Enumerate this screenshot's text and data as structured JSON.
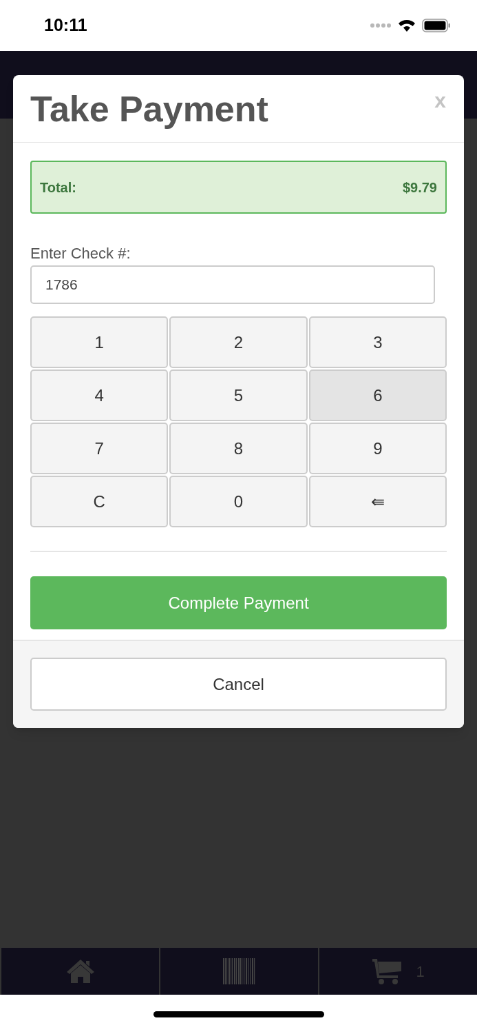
{
  "status_bar": {
    "time": "10:11"
  },
  "modal": {
    "title": "Take Payment",
    "close": "x",
    "total": {
      "label": "Total:",
      "amount": "$9.79"
    },
    "check_field": {
      "label": "Enter Check #:",
      "value": "1786"
    },
    "keypad": [
      {
        "label": "1",
        "pressed": false
      },
      {
        "label": "2",
        "pressed": false
      },
      {
        "label": "3",
        "pressed": false
      },
      {
        "label": "4",
        "pressed": false
      },
      {
        "label": "5",
        "pressed": false
      },
      {
        "label": "6",
        "pressed": true
      },
      {
        "label": "7",
        "pressed": false
      },
      {
        "label": "8",
        "pressed": false
      },
      {
        "label": "9",
        "pressed": false
      },
      {
        "label": "C",
        "pressed": false
      },
      {
        "label": "0",
        "pressed": false
      },
      {
        "label": "⇚",
        "pressed": false
      }
    ],
    "complete_button": "Complete Payment",
    "cancel_button": "Cancel"
  },
  "bottom_nav": {
    "cart_count": "1"
  }
}
